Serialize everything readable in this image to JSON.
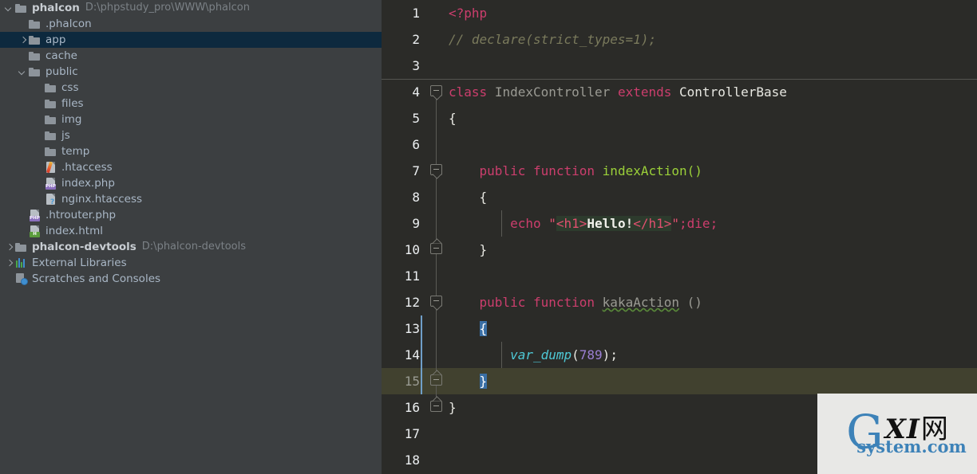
{
  "sidebar": {
    "items": [
      {
        "indent": 0,
        "arrow": "down",
        "icon": "folder-icon",
        "label": "phalcon",
        "bold": true,
        "path": "D:\\phpstudy_pro\\WWW\\phalcon",
        "selected": false
      },
      {
        "indent": 1,
        "arrow": "none",
        "icon": "folder-icon",
        "label": ".phalcon",
        "bold": false,
        "path": "",
        "selected": false
      },
      {
        "indent": 1,
        "arrow": "right",
        "icon": "folder-icon",
        "label": "app",
        "bold": false,
        "path": "",
        "selected": true
      },
      {
        "indent": 1,
        "arrow": "none",
        "icon": "folder-icon",
        "label": "cache",
        "bold": false,
        "path": "",
        "selected": false
      },
      {
        "indent": 1,
        "arrow": "down",
        "icon": "folder-icon",
        "label": "public",
        "bold": false,
        "path": "",
        "selected": false
      },
      {
        "indent": 2,
        "arrow": "none",
        "icon": "folder-icon",
        "label": "css",
        "bold": false,
        "path": "",
        "selected": false
      },
      {
        "indent": 2,
        "arrow": "none",
        "icon": "folder-icon",
        "label": "files",
        "bold": false,
        "path": "",
        "selected": false
      },
      {
        "indent": 2,
        "arrow": "none",
        "icon": "folder-icon",
        "label": "img",
        "bold": false,
        "path": "",
        "selected": false
      },
      {
        "indent": 2,
        "arrow": "none",
        "icon": "folder-icon",
        "label": "js",
        "bold": false,
        "path": "",
        "selected": false
      },
      {
        "indent": 2,
        "arrow": "none",
        "icon": "folder-icon",
        "label": "temp",
        "bold": false,
        "path": "",
        "selected": false
      },
      {
        "indent": 2,
        "arrow": "none",
        "icon": "htaccess-file-icon",
        "label": ".htaccess",
        "bold": false,
        "path": "",
        "selected": false
      },
      {
        "indent": 2,
        "arrow": "none",
        "icon": "php-file-icon",
        "label": "index.php",
        "bold": false,
        "path": "",
        "selected": false
      },
      {
        "indent": 2,
        "arrow": "none",
        "icon": "unknown-file-icon",
        "label": "nginx.htaccess",
        "bold": false,
        "path": "",
        "selected": false
      },
      {
        "indent": 1,
        "arrow": "none",
        "icon": "php-file-icon",
        "label": ".htrouter.php",
        "bold": false,
        "path": "",
        "selected": false
      },
      {
        "indent": 1,
        "arrow": "none",
        "icon": "html-file-icon",
        "label": "index.html",
        "bold": false,
        "path": "",
        "selected": false
      },
      {
        "indent": 0,
        "arrow": "right",
        "icon": "folder-icon",
        "label": "phalcon-devtools",
        "bold": true,
        "path": "D:\\phalcon-devtools",
        "selected": false
      },
      {
        "indent": 0,
        "arrow": "right",
        "icon": "libraries-icon",
        "label": "External Libraries",
        "bold": false,
        "path": "",
        "selected": false
      },
      {
        "indent": 0,
        "arrow": "none",
        "icon": "scratches-icon",
        "label": "Scratches and Consoles",
        "bold": false,
        "path": "",
        "selected": false
      }
    ]
  },
  "editor": {
    "language": "php",
    "current_line": 15,
    "line_numbers": [
      "1",
      "2",
      "3",
      "4",
      "5",
      "6",
      "7",
      "8",
      "9",
      "10",
      "11",
      "12",
      "13",
      "14",
      "15",
      "16",
      "17",
      "18"
    ],
    "lines": [
      {
        "n": "1",
        "text": "<?php"
      },
      {
        "n": "2",
        "text": "// declare(strict_types=1);"
      },
      {
        "n": "3",
        "text": ""
      },
      {
        "n": "4",
        "text": "class IndexController extends ControllerBase"
      },
      {
        "n": "5",
        "text": "{"
      },
      {
        "n": "6",
        "text": ""
      },
      {
        "n": "7",
        "text": "    public function indexAction()"
      },
      {
        "n": "8",
        "text": "    {"
      },
      {
        "n": "9",
        "text": "        echo \"<h1>Hello!</h1>\";die;"
      },
      {
        "n": "10",
        "text": "    }"
      },
      {
        "n": "11",
        "text": ""
      },
      {
        "n": "12",
        "text": "    public function kakaAction ()"
      },
      {
        "n": "13",
        "text": "    {"
      },
      {
        "n": "14",
        "text": "        var_dump(789);"
      },
      {
        "n": "15",
        "text": "    }"
      },
      {
        "n": "16",
        "text": "}"
      },
      {
        "n": "17",
        "text": ""
      },
      {
        "n": "18",
        "text": ""
      }
    ],
    "tokens": {
      "php_open": "<?php",
      "comment": "// declare(strict_types=1);",
      "kw_class": "class",
      "class_name": "IndexController",
      "kw_extends": "extends",
      "base_class": "ControllerBase",
      "brace_open": "{",
      "brace_close": "}",
      "kw_public": "public",
      "kw_function": "function",
      "fn_index": "indexAction()",
      "kw_echo": "echo",
      "quote": "\"",
      "tag_open": "<h1>",
      "html_text": "Hello!",
      "tag_close": "</h1>",
      "semi": ";",
      "kw_die": "die",
      "fn_kaka": "kakaAction",
      "kaka_parens": "()",
      "fn_var_dump": "var_dump",
      "paren_open": "(",
      "number_789": "789",
      "paren_close": ")"
    }
  },
  "watermark": {
    "letter_g": "G",
    "letters_xi": "XI",
    "cjk": "网",
    "domain": "system.com"
  },
  "colors": {
    "sidebar_bg": "#3c3f41",
    "sidebar_selected": "#0d293e",
    "editor_bg": "#2b2b28",
    "current_line": "#41412f",
    "keyword": "#cc3e6d",
    "function": "#9bd039",
    "comment": "#7a7a5c",
    "number": "#9b7fd4",
    "builtin_fn": "#4ec9d6",
    "brace_match": "#3a6fa5",
    "watermark_blue": "#3d82b8"
  }
}
